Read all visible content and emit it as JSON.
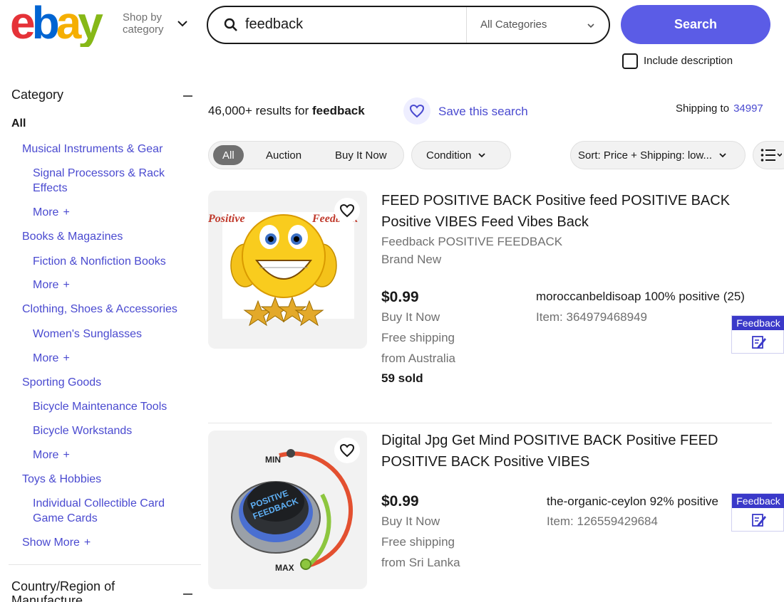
{
  "header": {
    "logo_text": "ebay",
    "shop_by_line1": "Shop by",
    "shop_by_line2": "category",
    "search_value": "feedback",
    "category_select": "All Categories",
    "search_button": "Search",
    "include_description": "Include description",
    "logo_colors": [
      "#e53238",
      "#0064d2",
      "#f5af02",
      "#86b817"
    ]
  },
  "sidebar": {
    "title": "Category",
    "all": "All",
    "links": [
      {
        "label": "Musical Instruments & Gear",
        "level": 1
      },
      {
        "label": "Signal Processors & Rack",
        "level": 2
      },
      {
        "label": "Effects",
        "level": 2
      },
      {
        "label": "More",
        "level": 2,
        "plus": "+"
      },
      {
        "label": "Books & Magazines",
        "level": 1
      },
      {
        "label": "Fiction & Nonfiction Books",
        "level": 2
      },
      {
        "label": "More",
        "level": 2,
        "plus": "+"
      },
      {
        "label": "Clothing, Shoes & Accessories",
        "level": 1
      },
      {
        "label": "Women's Sunglasses",
        "level": 2
      },
      {
        "label": "More",
        "level": 2,
        "plus": "+"
      },
      {
        "label": "Sporting Goods",
        "level": 1
      },
      {
        "label": "Bicycle Maintenance Tools",
        "level": 2
      },
      {
        "label": "Bicycle Workstands",
        "level": 2
      },
      {
        "label": "More",
        "level": 2,
        "plus": "+"
      },
      {
        "label": "Toys & Hobbies",
        "level": 1
      },
      {
        "label": "Individual Collectible Card",
        "level": 2
      },
      {
        "label": "Game Cards",
        "level": 2
      },
      {
        "label": "Show More",
        "level": 1,
        "plus": "+"
      }
    ],
    "country_title_line1": "Country/Region of",
    "country_title_line2": "Manufacture"
  },
  "results": {
    "count": "46,000+ results for",
    "query": "feedback",
    "save_search": "Save this search",
    "shipping_to": "Shipping to",
    "zip": "34997"
  },
  "filters": {
    "all": "All",
    "auction": "Auction",
    "buy_it_now": "Buy It Now",
    "condition": "Condition",
    "sort": "Sort: Price + Shipping: low..."
  },
  "listings": [
    {
      "title_line1": "FEED POSITIVE BACK Positive feed POSITIVE BACK",
      "title_line2": "Positive VIBES Feed Vibes Back",
      "subtitle": "Feedback POSITIVE FEEDBACK",
      "condition": "Brand New",
      "price": "$0.99",
      "format": "Buy It Now",
      "shipping": "Free shipping",
      "location": "from Australia",
      "sold": "59 sold",
      "seller": "moroccanbeldisoap 100% positive (25)",
      "item_number": "Item: 364979468949",
      "image_text_left": "Positive",
      "image_text_right": "Feedback",
      "feedback_tab": "Feedback"
    },
    {
      "title_line1": "Digital Jpg Get Mind POSITIVE BACK Positive FEED",
      "title_line2": "POSITIVE BACK Positive VIBES",
      "price": "$0.99",
      "format": "Buy It Now",
      "shipping": "Free shipping",
      "location": "from Sri Lanka",
      "seller": "the-organic-ceylon 92% positive",
      "item_number": "Item: 126559429684",
      "image_knob_line1": "POSITIVE",
      "image_knob_line2": "FEEDBACK",
      "image_min": "MIN",
      "image_max": "MAX",
      "feedback_tab": "Feedback"
    }
  ],
  "colors": {
    "accent": "#5b5ce6",
    "link": "#4a4ad0"
  }
}
